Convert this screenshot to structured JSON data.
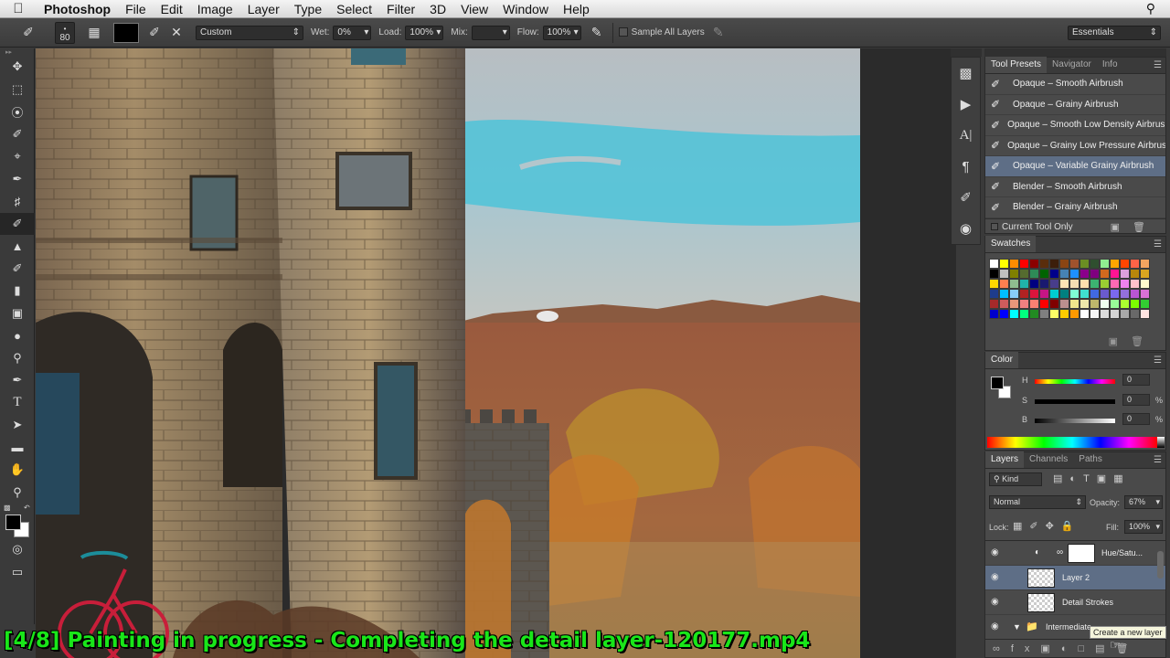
{
  "menubar": {
    "app_name": "Photoshop",
    "items": [
      "File",
      "Edit",
      "Image",
      "Layer",
      "Type",
      "Select",
      "Filter",
      "3D",
      "View",
      "Window",
      "Help"
    ]
  },
  "options": {
    "brush_size": "80",
    "preset": "Custom",
    "wet_label": "Wet:",
    "wet_value": "0%",
    "load_label": "Load:",
    "load_value": "100%",
    "mix_label": "Mix:",
    "mix_value": "",
    "flow_label": "Flow:",
    "flow_value": "100%",
    "sample_all_layers": "Sample All Layers",
    "workspace": "Essentials"
  },
  "tool_presets": {
    "tabs": [
      "Tool Presets",
      "Navigator",
      "Info"
    ],
    "items": [
      "Opaque – Smooth Airbrush",
      "Opaque – Grainy Airbrush",
      "Opaque – Smooth Low Density Airbrush",
      "Opaque – Grainy Low Pressure Airbrush",
      "Opaque – Variable Grainy Airbrush",
      "Blender – Smooth Airbrush",
      "Blender – Grainy Airbrush"
    ],
    "selected_index": 4,
    "current_tool_only": "Current Tool Only"
  },
  "swatches": {
    "title": "Swatches",
    "colors": [
      "#ffffff",
      "#ffff00",
      "#ff8c00",
      "#ff0000",
      "#8b0000",
      "#5a2d0c",
      "#3c1e0a",
      "#8b4513",
      "#a0522d",
      "#6b8e23",
      "#2f4f2f",
      "#90ee90",
      "#ffa500",
      "#ff4500",
      "#ff6347",
      "#f4a460",
      "#000000",
      "#c0c0c0",
      "#808000",
      "#556b2f",
      "#2e8b57",
      "#006400",
      "#00008b",
      "#4682b4",
      "#1e90ff",
      "#8b008b",
      "#800080",
      "#d2691e",
      "#ff1493",
      "#dda0dd",
      "#b8860b",
      "#daa520",
      "#ffd700",
      "#ff7f50",
      "#8fbc8f",
      "#20b2aa",
      "#000080",
      "#191970",
      "#483d8b",
      "#ffe4b5",
      "#f5deb3",
      "#ffdead",
      "#3cb371",
      "#9acd32",
      "#ff69b4",
      "#ee82ee",
      "#ffc0cb",
      "#fffacd",
      "#1e3c8c",
      "#00bfff",
      "#87cefa",
      "#b22222",
      "#dc143c",
      "#c71585",
      "#00ced1",
      "#008080",
      "#7fffd4",
      "#40e0d0",
      "#4169e1",
      "#6a5acd",
      "#7b68ee",
      "#9370db",
      "#ba55d3",
      "#da70d6",
      "#a52a2a",
      "#cd5c5c",
      "#e9967a",
      "#f08080",
      "#fa8072",
      "#ff0000",
      "#800000",
      "#bc8f8f",
      "#f0e68c",
      "#eee8aa",
      "#bdb76b",
      "#f0fff0",
      "#98fb98",
      "#adff2f",
      "#7cfc00",
      "#32cd32",
      "#0000cd",
      "#0000ff",
      "#00ffff",
      "#00ff7f",
      "#228b22",
      "#808080",
      "#ffff66",
      "#ffcc00",
      "#ff9900",
      "#ffffff",
      "#f5f5f5",
      "#dcdcdc",
      "#d3d3d3",
      "#a9a9a9",
      "#696969",
      "#ffe4e1"
    ]
  },
  "color_panel": {
    "title": "Color",
    "h_label": "H",
    "h_value": "0",
    "s_label": "S",
    "s_value": "0",
    "s_unit": "%",
    "b_label": "B",
    "b_value": "0",
    "b_unit": "%"
  },
  "layers": {
    "tabs": [
      "Layers",
      "Channels",
      "Paths"
    ],
    "kind_filter": "Kind",
    "blend_mode": "Normal",
    "opacity_label": "Opacity:",
    "opacity_value": "67%",
    "lock_label": "Lock:",
    "fill_label": "Fill:",
    "fill_value": "100%",
    "rows": [
      {
        "name": "Hue/Satu..."
      },
      {
        "name": "Layer 2"
      },
      {
        "name": "Detail Strokes"
      },
      {
        "name": "Intermediate"
      }
    ],
    "selected_index": 1,
    "tooltip": "Create a new layer"
  },
  "caption": "[4/8] Painting in progress - Completing the detail layer-120177.mp4"
}
